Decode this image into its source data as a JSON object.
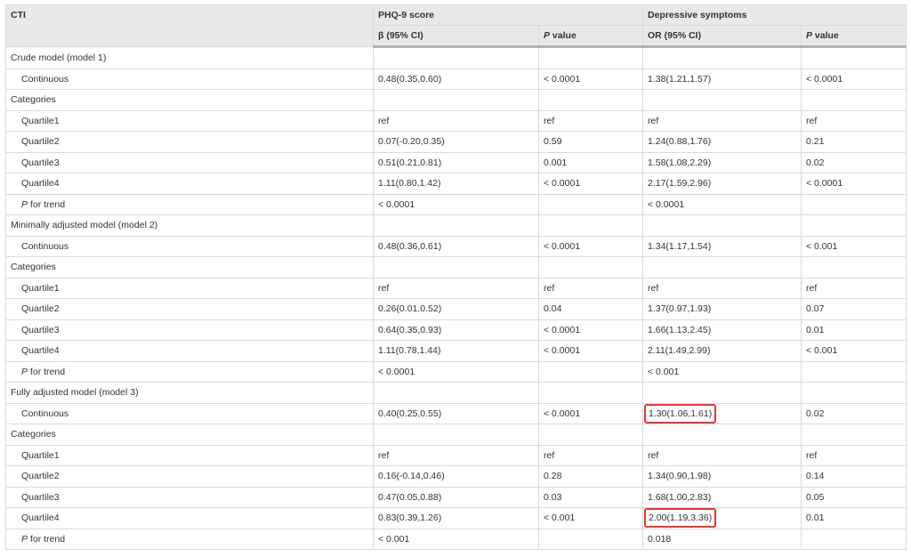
{
  "header": {
    "cti": "CTI",
    "phq_group": "PHQ-9 score",
    "dep_group": "Depressive symptoms",
    "beta_ci": "β (95% CI)",
    "p_label_italic": "P",
    "p_label_rest": " value",
    "or_ci": "OR (95% CI)"
  },
  "sections": [
    {
      "title": "Crude model (model 1)",
      "continuous": {
        "label": "Continuous",
        "beta": "0.48(0.35,0.60)",
        "p1": "< 0.0001",
        "or": "1.38(1.21,1.57)",
        "p2": "< 0.0001"
      },
      "categories_label": "Categories",
      "quartiles": [
        {
          "label": "Quartile1",
          "beta": "ref",
          "p1": "ref",
          "or": "ref",
          "p2": "ref"
        },
        {
          "label": "Quartile2",
          "beta": "0.07(-0.20,0.35)",
          "p1": "0.59",
          "or": "1.24(0.88,1.76)",
          "p2": "0.21"
        },
        {
          "label": "Quartile3",
          "beta": "0.51(0.21,0.81)",
          "p1": "0.001",
          "or": "1.58(1.08,2.29)",
          "p2": "0.02"
        },
        {
          "label": "Quartile4",
          "beta": "1.11(0.80,1.42)",
          "p1": "< 0.0001",
          "or": "2.17(1.59,2.96)",
          "p2": "< 0.0001"
        }
      ],
      "trend": {
        "label_italic": "P",
        "label_rest": " for trend",
        "beta": "< 0.0001",
        "or": "< 0.0001"
      }
    },
    {
      "title": "Minimally adjusted model (model 2)",
      "continuous": {
        "label": "Continuous",
        "beta": "0.48(0.36,0.61)",
        "p1": "< 0.0001",
        "or": "1.34(1.17,1.54)",
        "p2": "< 0.001"
      },
      "categories_label": "Categories",
      "quartiles": [
        {
          "label": "Quartile1",
          "beta": "ref",
          "p1": "ref",
          "or": "ref",
          "p2": "ref"
        },
        {
          "label": "Quartile2",
          "beta": "0.26(0.01,0.52)",
          "p1": "0.04",
          "or": "1.37(0.97,1.93)",
          "p2": "0.07"
        },
        {
          "label": "Quartile3",
          "beta": "0.64(0.35,0.93)",
          "p1": "< 0.0001",
          "or": "1.66(1.13,2.45)",
          "p2": "0.01"
        },
        {
          "label": "Quartile4",
          "beta": "1.11(0.78,1.44)",
          "p1": "< 0.0001",
          "or": "2.11(1.49,2.99)",
          "p2": "< 0.001"
        }
      ],
      "trend": {
        "label_italic": "P",
        "label_rest": " for trend",
        "beta": "< 0.0001",
        "or": "< 0.001"
      }
    },
    {
      "title": "Fully adjusted model (model 3)",
      "continuous": {
        "label": "Continuous",
        "beta": "0.40(0.25,0.55)",
        "p1": "< 0.0001",
        "or": "1.30(1.06,1.61)",
        "p2": "0.02"
      },
      "categories_label": "Categories",
      "quartiles": [
        {
          "label": "Quartile1",
          "beta": "ref",
          "p1": "ref",
          "or": "ref",
          "p2": "ref"
        },
        {
          "label": "Quartile2",
          "beta": "0.16(-0.14,0.46)",
          "p1": "0.28",
          "or": "1.34(0.90,1.98)",
          "p2": "0.14"
        },
        {
          "label": "Quartile3",
          "beta": "0.47(0.05,0.88)",
          "p1": "0.03",
          "or": "1.68(1.00,2.83)",
          "p2": "0.05"
        },
        {
          "label": "Quartile4",
          "beta": "0.83(0.39,1.26)",
          "p1": "< 0.001",
          "or": "2.00(1.19,3.36)",
          "p2": "0.01"
        }
      ],
      "trend": {
        "label_italic": "P",
        "label_rest": " for trend",
        "beta": "< 0.001",
        "or": "0.018"
      }
    }
  ],
  "highlight_color": "#e53935"
}
